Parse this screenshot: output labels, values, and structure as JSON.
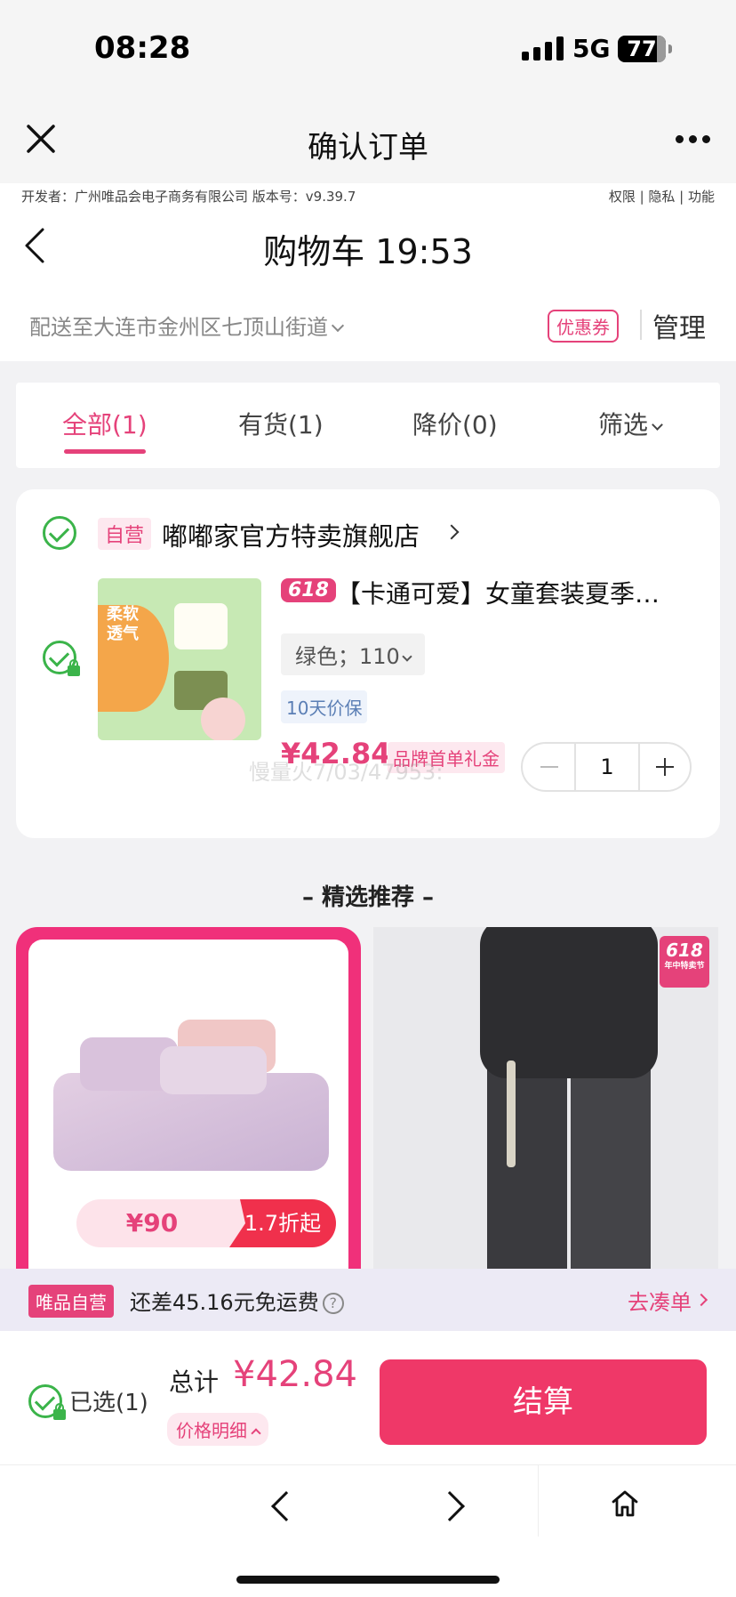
{
  "status": {
    "time": "08:28",
    "network": "5G",
    "battery": "77"
  },
  "mini_header": {
    "title": "确认订单"
  },
  "dev_info": {
    "left": "开发者：广州唯品会电子商务有限公司 版本号：v9.39.7",
    "right": "权限 | 隐私 | 功能"
  },
  "page": {
    "title": "购物车 19:53",
    "address": "配送至大连市金州区七顶山街道",
    "coupon": "优惠券",
    "manage": "管理"
  },
  "tabs": [
    {
      "label": "全部(1)",
      "active": true
    },
    {
      "label": "有货(1)",
      "active": false
    },
    {
      "label": "降价(0)",
      "active": false
    },
    {
      "label": "筛选",
      "active": false
    }
  ],
  "cart": {
    "store_tag": "自营",
    "store_name": "嘟嘟家官方特卖旗舰店",
    "thumb_text": "柔软透气",
    "product": {
      "badge": "618",
      "title": "【卡通可爱】女童套装夏季…",
      "variant": "绿色；110",
      "guarantee": "10天价保",
      "price": "¥42.84",
      "gift": "品牌首单礼金",
      "quantity": "1"
    },
    "watermark": "慢量火7/03/47953:"
  },
  "recommend": {
    "title": "– 精选推荐 –",
    "item1": {
      "price": "¥90",
      "discount": "1.7折起"
    },
    "item2": {
      "tag": "618",
      "tag_sub": "年中特卖节"
    }
  },
  "freight": {
    "tag": "唯品自营",
    "message": "还差45.16元免运费",
    "help_icon": "?",
    "action": "去凑单"
  },
  "checkout": {
    "selected": "已选(1)",
    "total_label": "总计",
    "total": "¥42.84",
    "detail": "价格明细",
    "pay": "结算"
  },
  "colors": {
    "accent": "#e5427a",
    "pay_button": "#ef3868",
    "check": "#3bb44a"
  }
}
